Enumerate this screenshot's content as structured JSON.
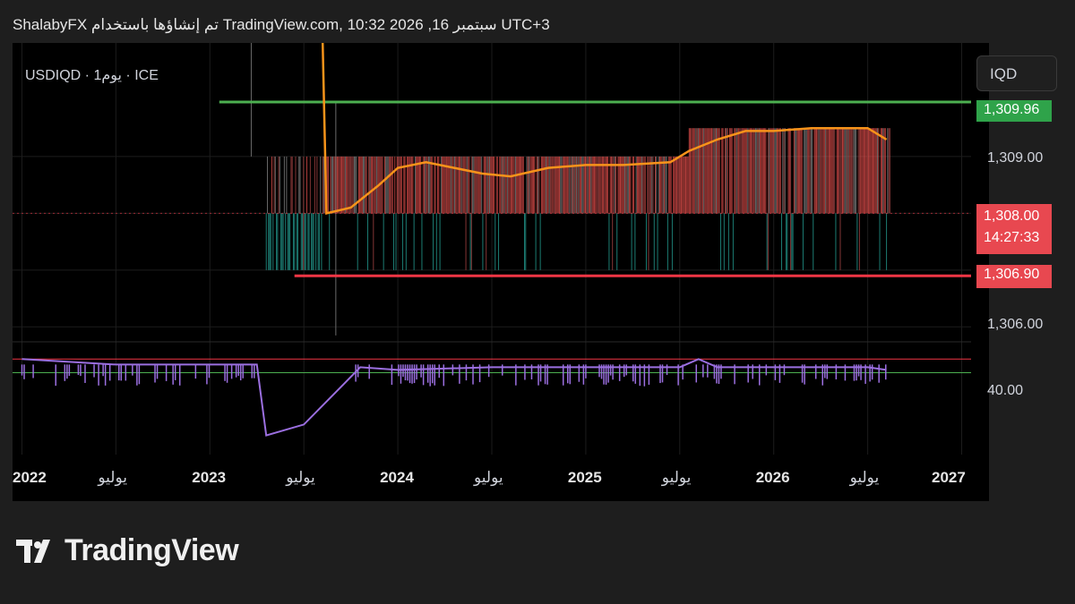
{
  "header": {
    "text": "ShalabyFX تم إنشاؤها باستخدام TradingView.com, 10:32 2026 ,16 سبتمبر UTC+3"
  },
  "symbol": {
    "label": "USDIQD · 1يوم · ICE"
  },
  "currency": "IQD",
  "colors": {
    "background": "#000000",
    "price_line": "#f7931a",
    "resistance": "#4caf50",
    "support": "#f23645",
    "oscillator": "#9b6fe0",
    "bull_bar": "#26a69a",
    "bear_bar": "#ef5350"
  },
  "price_tags": {
    "resistance": "1,309.96",
    "last_price": "1,308.00",
    "countdown": "14:27:33",
    "support": "1,306.90"
  },
  "y_axis_labels": [
    "1,309.00",
    "1,306.00"
  ],
  "oscillator_label": "40.00",
  "x_axis_labels": [
    {
      "text": "2022",
      "strong": true
    },
    {
      "text": "يوليو",
      "strong": false
    },
    {
      "text": "2023",
      "strong": true
    },
    {
      "text": "يوليو",
      "strong": false
    },
    {
      "text": "2024",
      "strong": true
    },
    {
      "text": "يوليو",
      "strong": false
    },
    {
      "text": "2025",
      "strong": true
    },
    {
      "text": "يوليو",
      "strong": false
    },
    {
      "text": "2026",
      "strong": true
    },
    {
      "text": "يوليو",
      "strong": false
    },
    {
      "text": "2027",
      "strong": true
    }
  ],
  "footer": {
    "brand": "TradingView"
  },
  "chart_data": {
    "type": "line",
    "title": "USDIQD · 1يوم · ICE",
    "ylabel": "IQD",
    "ylim": [
      1305.8,
      1311.0
    ],
    "grid": true,
    "lines": {
      "resistance": 1309.96,
      "support": 1306.9,
      "last_price": 1308.0
    },
    "price_ma": {
      "x": [
        2023.62,
        2023.75,
        2023.9,
        2024.0,
        2024.15,
        2024.3,
        2024.45,
        2024.6,
        2024.8,
        2025.0,
        2025.2,
        2025.45,
        2025.55,
        2025.7,
        2025.85,
        2026.0,
        2026.2,
        2026.35,
        2026.5,
        2026.6
      ],
      "values": [
        1308.0,
        1308.1,
        1308.5,
        1308.8,
        1308.9,
        1308.8,
        1308.7,
        1308.65,
        1308.8,
        1308.85,
        1308.85,
        1308.9,
        1309.1,
        1309.3,
        1309.45,
        1309.45,
        1309.5,
        1309.5,
        1309.5,
        1309.3
      ]
    },
    "oscillator": {
      "reference_label": "40.00",
      "x": [
        2022.0,
        2022.5,
        2023.0,
        2023.25,
        2023.3,
        2023.5,
        2023.7,
        2023.8,
        2024.0,
        2024.5,
        2025.0,
        2025.5,
        2025.6,
        2025.7,
        2026.0,
        2026.5,
        2026.6
      ],
      "values": [
        50,
        48,
        48,
        48,
        22,
        26,
        40,
        47,
        46,
        47,
        47,
        47,
        50,
        47,
        47,
        47,
        46
      ]
    }
  }
}
